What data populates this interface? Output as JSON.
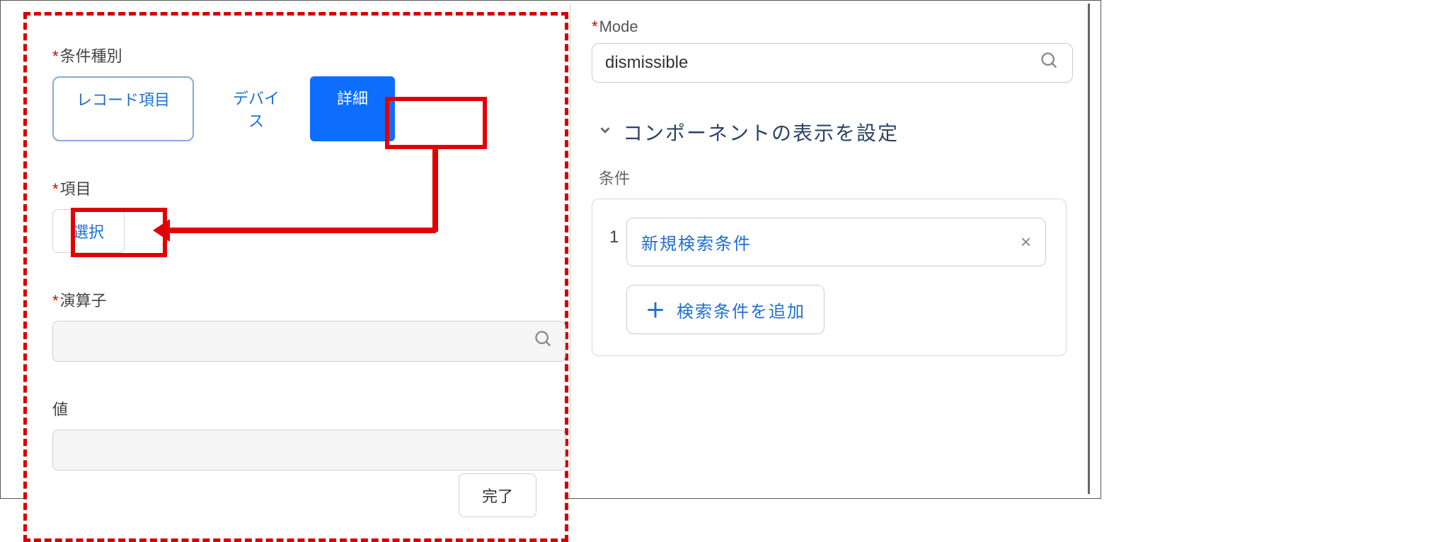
{
  "left": {
    "condition_type_label": "条件種別",
    "seg_record": "レコード項目",
    "seg_device": "デバイス",
    "seg_detail": "詳細",
    "item_label": "項目",
    "select_button": "選択",
    "operator_label": "演算子",
    "operator_value": "",
    "value_label": "値",
    "value_value": "",
    "done_button": "完了"
  },
  "right": {
    "mode_label": "Mode",
    "mode_value": "dismissible",
    "section_title": "コンポーネントの表示を設定",
    "conditions_label": "条件",
    "conditions": [
      {
        "index": "1",
        "name": "新規検索条件"
      }
    ],
    "add_condition_label": "検索条件を追加"
  }
}
